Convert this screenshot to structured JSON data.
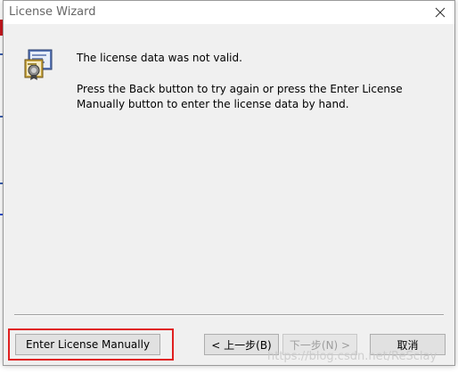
{
  "window": {
    "title": "License Wizard",
    "close_icon": "close-icon"
  },
  "header": {
    "icon": "license-certificate-icon"
  },
  "message": {
    "line1": "The license data was not valid.",
    "paragraph": "Press the Back button to try again or press the Enter License Manually button to enter the license data by hand."
  },
  "buttons": {
    "enter_manually": "Enter License Manually",
    "back": "< 上一步(B)",
    "next": "下一步(N) >",
    "cancel": "取消"
  },
  "annotation": {
    "highlight_color": "#e02020"
  },
  "watermark": {
    "text": "https://blog.csdn.net/ReSclay"
  },
  "colors": {
    "dialog_bg": "#f0f0f0",
    "button_bg": "#e1e1e1",
    "disabled_text": "#9d9d9d"
  }
}
